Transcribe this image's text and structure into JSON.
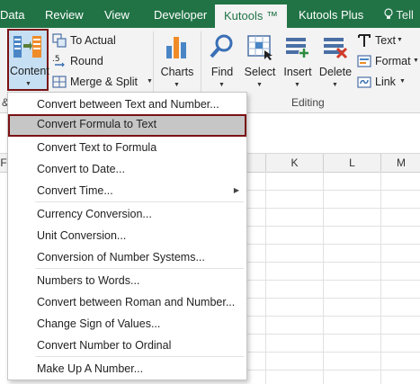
{
  "tabs": {
    "data": "Data",
    "review": "Review",
    "view": "View",
    "developer": "Developer",
    "kutools": "Kutools ™",
    "kutools_plus": "Kutools Plus",
    "tell": "Tell"
  },
  "ribbon": {
    "content_label": "Content",
    "to_actual": "To Actual",
    "round": "Round",
    "merge_split": "Merge & Split",
    "charts": "Charts",
    "find": "Find",
    "select": "Select",
    "insert": "Insert",
    "delete": "Delete",
    "text": "Text",
    "format": "Format",
    "link": "Link",
    "group_editing": "Editing",
    "group_left_partial": "&"
  },
  "columns": [
    "F",
    "K",
    "L",
    "M"
  ],
  "menu": {
    "items": [
      "Convert between Text and Number...",
      "Convert Formula to Text",
      "Convert Text to Formula",
      "Convert to Date...",
      "Convert Time...",
      "Currency Conversion...",
      "Unit Conversion...",
      "Conversion of Number Systems...",
      "Numbers to Words...",
      "Convert between Roman and Number...",
      "Change Sign of Values...",
      "Convert Number to Ordinal",
      "Make Up A Number..."
    ],
    "highlighted_index": 1
  },
  "colors": {
    "excel_green": "#217346",
    "highlight_border": "#7b1113",
    "highlight_fill": "#c6c6c6",
    "ribbon_bg": "#f3f3f3"
  }
}
